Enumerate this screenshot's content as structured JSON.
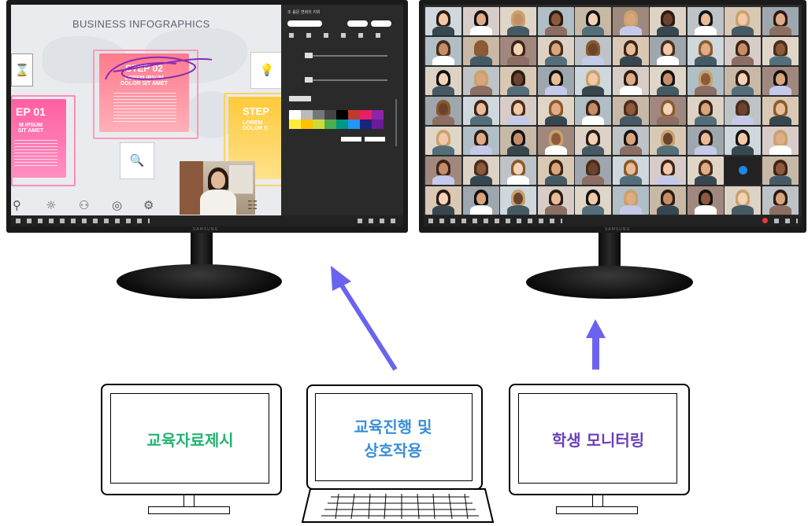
{
  "left_monitor": {
    "slide_title": "BUSINESS INFOGRAPHICS",
    "step02": "STEP 02",
    "step02_sub": "LOREM IPSUM\nDOLOR SIT AMET",
    "step01": "EP 01",
    "step01_sub": "M IPSUM\nSIT AMET",
    "step03": "STEP",
    "step03_sub": "LOREM\nDOLOR S",
    "panel_title": "조 음문 변화의 지위",
    "brand": "SAMSUNG"
  },
  "right_monitor": {
    "brand": "SAMSUNG"
  },
  "devices": {
    "left_label": "교육자료제시",
    "center_label_line1": "교육진행 및",
    "center_label_line2": "상호작용",
    "right_label": "학생 모니터링"
  },
  "colors": {
    "left_label": "#22b573",
    "center_label": "#3b8fd6",
    "right_label": "#6a3fb5",
    "arrow": "#6b63f0"
  }
}
